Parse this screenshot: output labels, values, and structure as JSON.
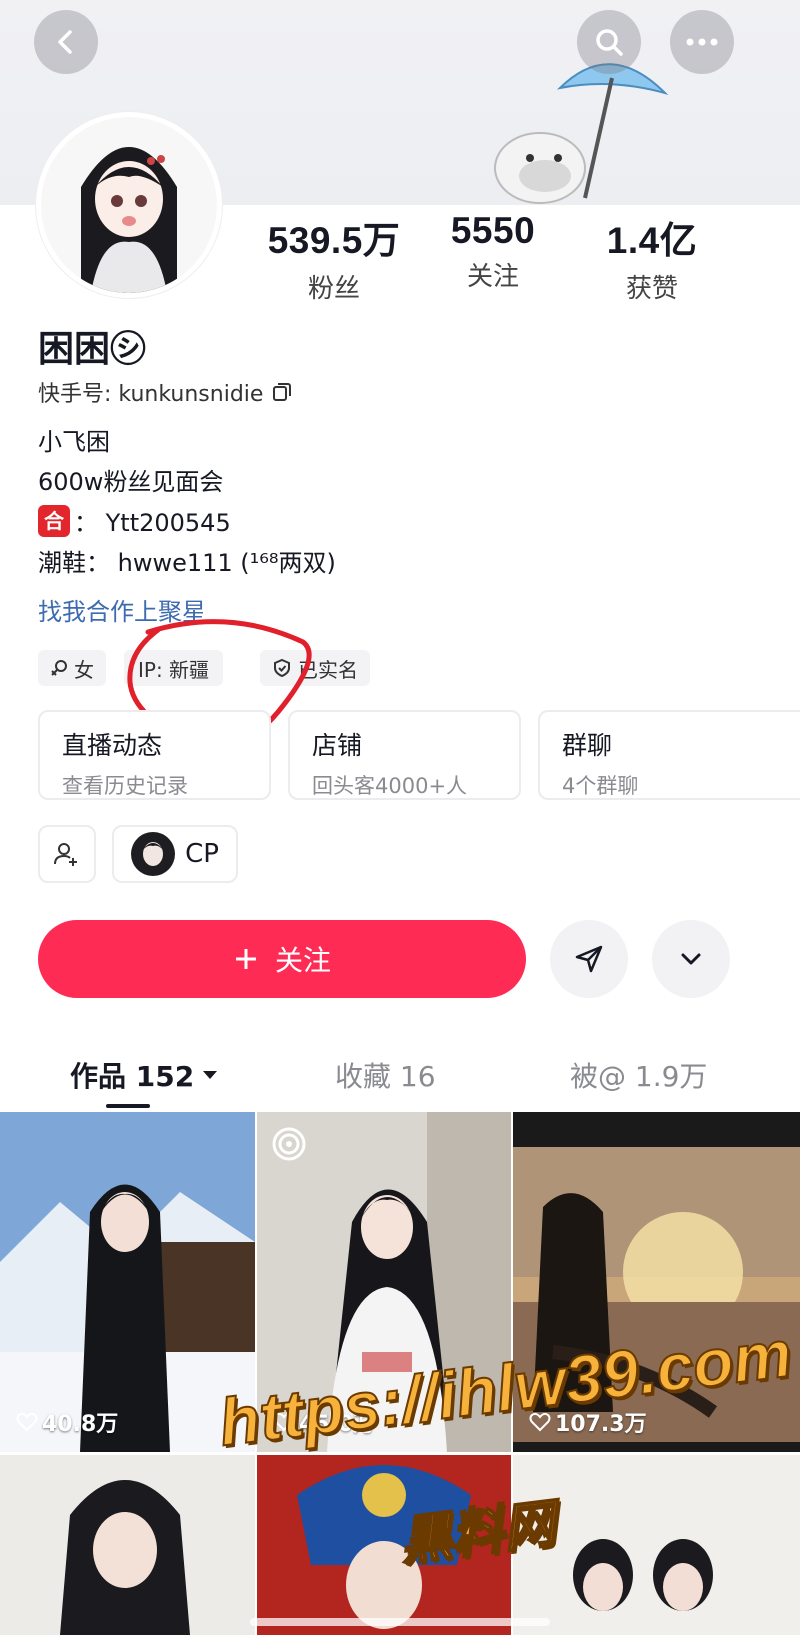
{
  "header": {
    "back_icon": "chevron-left-icon",
    "search_icon": "search-icon",
    "more_icon": "more-horizontal-icon"
  },
  "stats": [
    {
      "value": "539.5万",
      "label": "粉丝"
    },
    {
      "value": "5550",
      "label": "关注"
    },
    {
      "value": "1.4亿",
      "label": "获赞"
    }
  ],
  "profile": {
    "name": "困困㋛",
    "kuaishou_id": "快手号: kunkunsnidie",
    "bio": [
      "小飞困",
      "600w粉丝见面会",
      "： Ytt200545",
      "潮鞋： hwwe111 (¹⁶⁸两双)"
    ],
    "bio_badge": "合",
    "link_text": "找我合作上聚星"
  },
  "tags": {
    "gender": "女",
    "ip": "IP: 新疆",
    "verified": "已实名"
  },
  "cards": [
    {
      "title": "直播动态",
      "subtitle": "查看历史记录"
    },
    {
      "title": "店铺",
      "subtitle": "回头客4000+人"
    },
    {
      "title": "群聊",
      "subtitle": "4个群聊"
    }
  ],
  "cp_label": "CP",
  "follow_button": "关注",
  "tabs": [
    {
      "label": "作品 152"
    },
    {
      "label": "收藏 16"
    },
    {
      "label": "被@ 1.9万"
    }
  ],
  "videos": [
    {
      "likes": "40.8万"
    },
    {
      "likes": "45.0万"
    },
    {
      "likes": "107.3万"
    }
  ],
  "watermark": {
    "url": "https://ihlw39.com",
    "name": "黑料网"
  },
  "colors": {
    "accent": "#fe2c55",
    "link": "#3d6bb0",
    "annotation": "#e0202a",
    "watermark": "#f6b23a"
  }
}
